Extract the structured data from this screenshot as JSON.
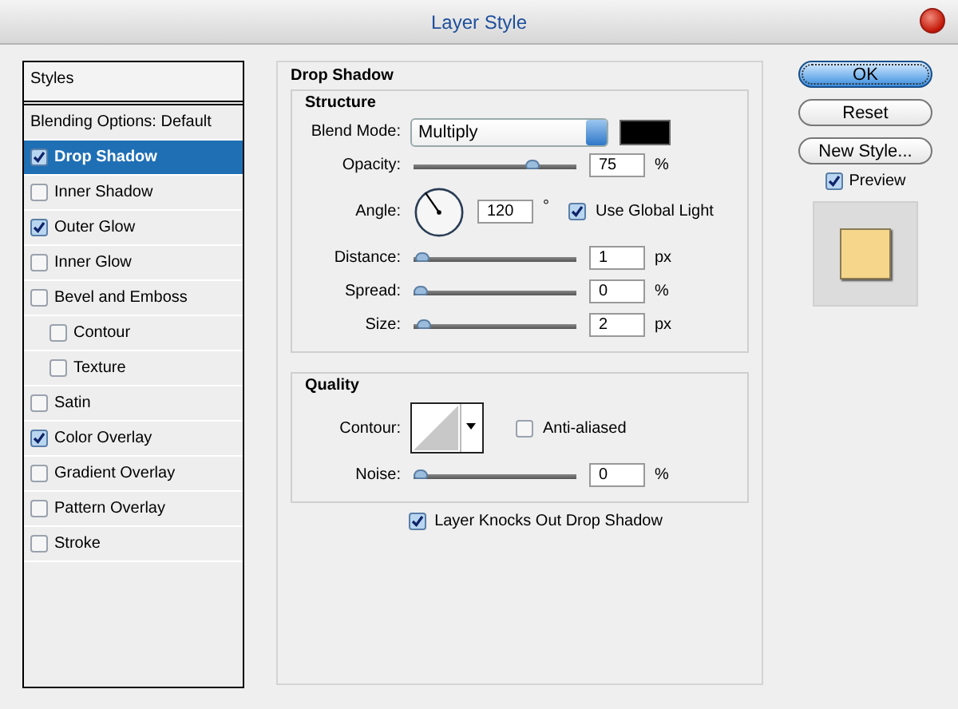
{
  "window": {
    "title": "Layer Style"
  },
  "styles_panel": {
    "header": "Styles",
    "items": [
      {
        "label": "Blending Options: Default",
        "kind": "plain",
        "selected": false
      },
      {
        "label": "Drop Shadow",
        "kind": "check",
        "checked": true,
        "selected": true
      },
      {
        "label": "Inner Shadow",
        "kind": "check",
        "checked": false,
        "selected": false
      },
      {
        "label": "Outer Glow",
        "kind": "check",
        "checked": true,
        "selected": false
      },
      {
        "label": "Inner Glow",
        "kind": "check",
        "checked": false,
        "selected": false
      },
      {
        "label": "Bevel and Emboss",
        "kind": "check",
        "checked": false,
        "selected": false,
        "children": [
          {
            "label": "Contour",
            "kind": "check",
            "checked": false,
            "selected": false
          },
          {
            "label": "Texture",
            "kind": "check",
            "checked": false,
            "selected": false
          }
        ]
      },
      {
        "label": "Satin",
        "kind": "check",
        "checked": false,
        "selected": false
      },
      {
        "label": "Color Overlay",
        "kind": "check",
        "checked": true,
        "selected": false
      },
      {
        "label": "Gradient Overlay",
        "kind": "check",
        "checked": false,
        "selected": false
      },
      {
        "label": "Pattern Overlay",
        "kind": "check",
        "checked": false,
        "selected": false
      },
      {
        "label": "Stroke",
        "kind": "check",
        "checked": false,
        "selected": false
      }
    ]
  },
  "settings": {
    "title": "Drop Shadow",
    "structure": {
      "title": "Structure",
      "rows": [
        {
          "kind": "select",
          "label": "Blend Mode:",
          "value": "Multiply",
          "color": "#000000"
        },
        {
          "kind": "slider",
          "label": "Opacity:",
          "level": 0.75,
          "value": "75",
          "unit": "%"
        },
        {
          "kind": "angle",
          "label": "Angle:",
          "value": "120",
          "unit": "°",
          "check_label": "Use Global Light",
          "checked": true
        },
        {
          "kind": "slider",
          "label": "Distance:",
          "level": 0.01,
          "value": "1",
          "unit": "px"
        },
        {
          "kind": "slider",
          "label": "Spread:",
          "level": 0,
          "value": "0",
          "unit": "%"
        },
        {
          "kind": "slider",
          "label": "Size:",
          "level": 0.02,
          "value": "2",
          "unit": "px"
        }
      ]
    },
    "quality": {
      "title": "Quality",
      "rows": [
        {
          "kind": "contour",
          "label": "Contour:",
          "check_label": "Anti-aliased",
          "checked": false
        },
        {
          "kind": "slider",
          "label": "Noise:",
          "level": 0,
          "value": "0",
          "unit": "%"
        }
      ]
    },
    "knockout": {
      "label": "Layer Knocks Out Drop Shadow",
      "checked": true
    }
  },
  "buttons": [
    {
      "label": "OK",
      "default": true
    },
    {
      "label": "Reset",
      "default": false
    },
    {
      "label": "New Style...",
      "default": false
    }
  ],
  "preview": {
    "label": "Preview",
    "checked": true,
    "color": "#f5d68a"
  }
}
